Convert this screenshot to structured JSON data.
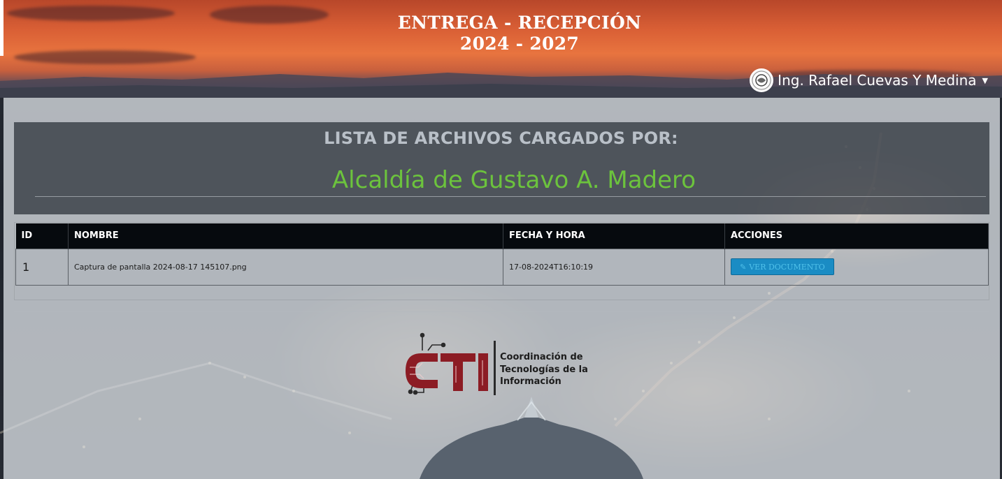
{
  "header": {
    "title_line1": "ENTREGA - RECEPCIÓN",
    "title_line2": "2024 - 2027",
    "user_name": "Ing. Rafael Cuevas Y Medina"
  },
  "heading": {
    "title": "LISTA DE ARCHIVOS CARGADOS POR:",
    "organization": "Alcaldía de Gustavo A. Madero"
  },
  "table": {
    "columns": [
      "ID",
      "NOMBRE",
      "FECHA Y HORA",
      "ACCIONES"
    ],
    "rows": [
      {
        "id": "1",
        "nombre": "Captura de pantalla 2024-08-17 145107.png",
        "fecha": "17-08-2024T16:10:19",
        "action_label": "VER DOCUMENTO",
        "action_icon": "edit-icon"
      }
    ]
  },
  "footer": {
    "logo_letters": "CTI",
    "logo_line1": "Coordinación de",
    "logo_line2": "Tecnologías de la",
    "logo_line3": "Información"
  },
  "colors": {
    "accent_green": "#6cc33d",
    "button_blue": "#1a8cc4",
    "logo_red": "#8c1c24"
  }
}
